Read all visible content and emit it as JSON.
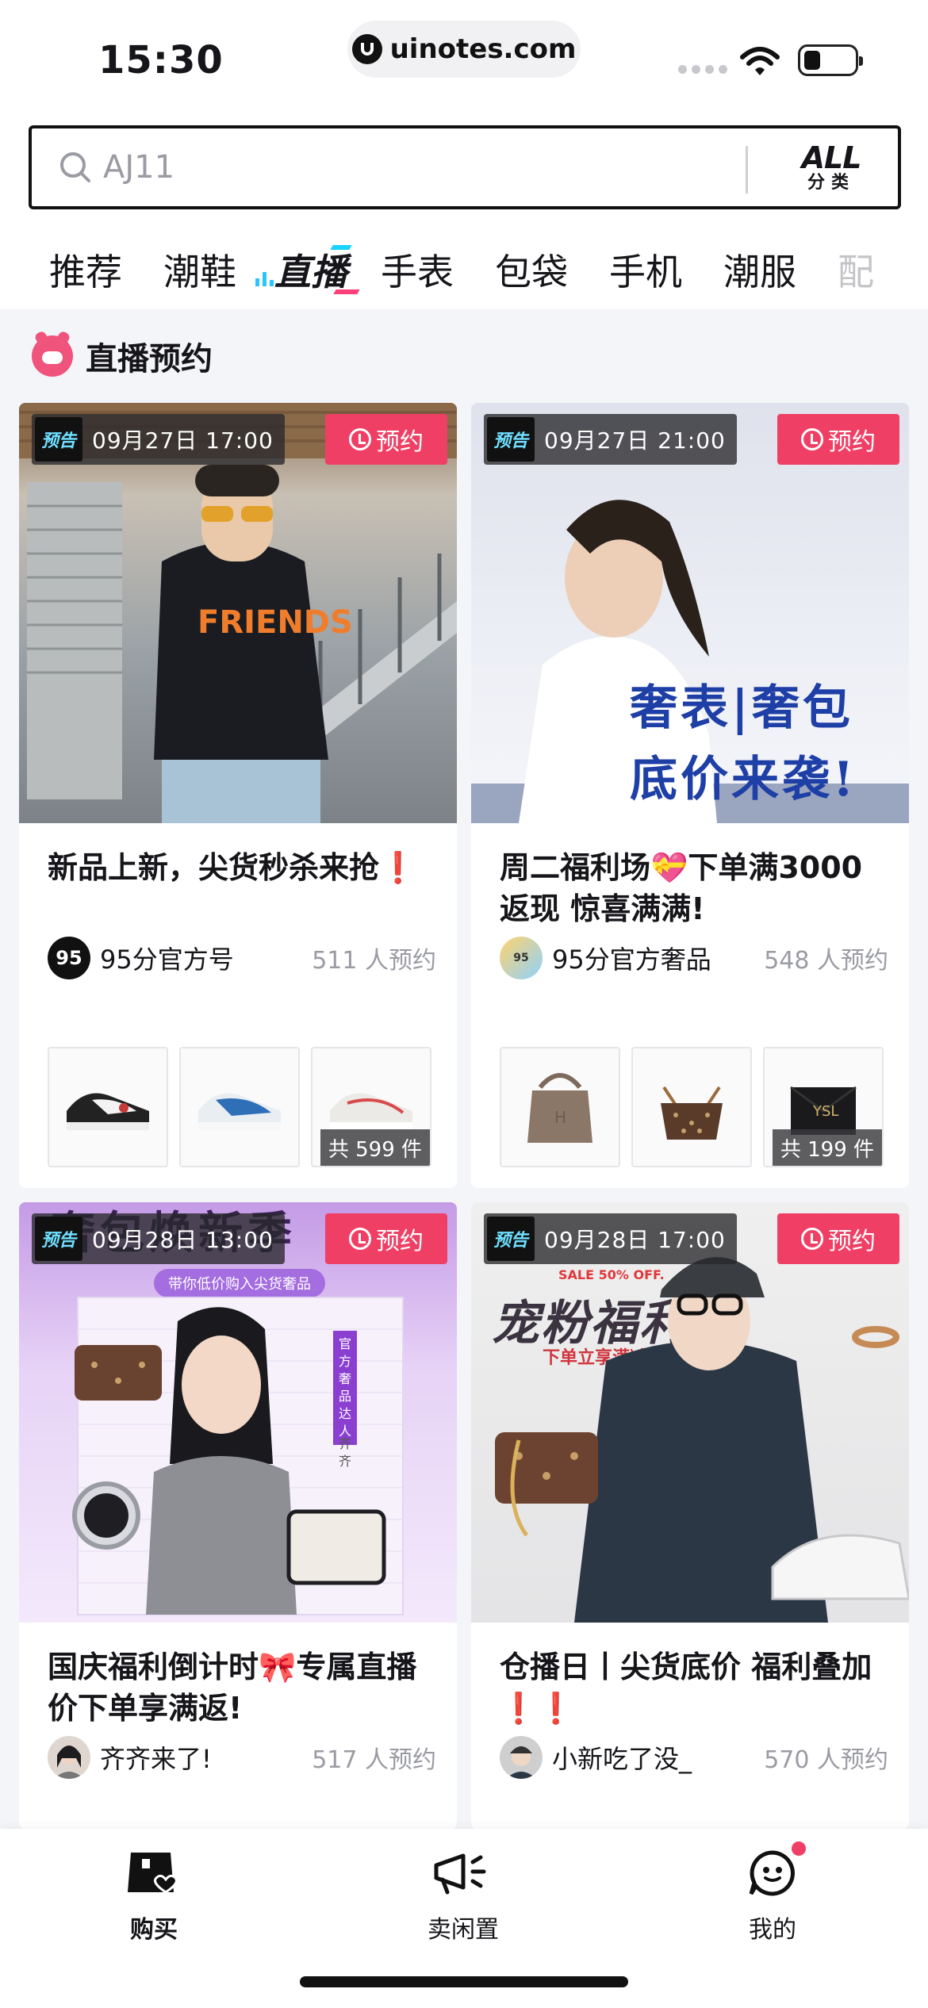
{
  "status_bar": {
    "time": "15:30",
    "url": "uinotes.com"
  },
  "search": {
    "placeholder": "AJ11",
    "all_label": "ALL",
    "all_sub": "分类"
  },
  "tabs": [
    {
      "label": "推荐"
    },
    {
      "label": "潮鞋"
    },
    {
      "label": "直播"
    },
    {
      "label": "手表"
    },
    {
      "label": "包袋"
    },
    {
      "label": "手机"
    },
    {
      "label": "潮服"
    },
    {
      "label": "配"
    }
  ],
  "section": {
    "title": "直播预约"
  },
  "cards": [
    {
      "tag": "预告",
      "time": "09月27日 17:00",
      "reserve": "预约",
      "title": "新品上新，尖货秒杀来抢❗️",
      "host_name": "95分官方号",
      "reserve_count": "511 人预约",
      "total": "共 599 件"
    },
    {
      "tag": "预告",
      "time": "09月27日 21:00",
      "reserve": "预约",
      "poster_line1": "奢表|奢包",
      "poster_line2": "底价来袭!",
      "title": "周二福利场💝下单满3000返现 惊喜满满!",
      "host_name": "95分官方奢品",
      "reserve_count": "548 人预约",
      "total": "共 199 件"
    },
    {
      "tag": "预告",
      "time": "09月28日 13:00",
      "reserve": "预约",
      "poster_head": "奢包焕新季",
      "poster_sub": "带你低价购入尖货奢品",
      "poster_side": "官方奢品达人",
      "poster_name": "齐齐",
      "title": "国庆福利倒计时🎀专属直播价下单享满返!",
      "host_name": "齐齐来了!",
      "reserve_count": "517 人预约"
    },
    {
      "tag": "预告",
      "time": "09月28日 17:00",
      "reserve": "预约",
      "poster_sale": "SALE 50% OFF.",
      "poster_head": "宠粉福利",
      "poster_sub": "下单立享满减",
      "title": "仓播日丨尖货底价 福利叠加❗️❗️",
      "host_name": "小新吃了没_",
      "reserve_count": "570 人预约"
    }
  ],
  "bottom_nav": [
    {
      "label": "购买"
    },
    {
      "label": "卖闲置"
    },
    {
      "label": "我的"
    }
  ],
  "colors": {
    "accent": "#f03f64",
    "tag_text": "#6fe0ff",
    "muted": "#9a9ba3"
  }
}
